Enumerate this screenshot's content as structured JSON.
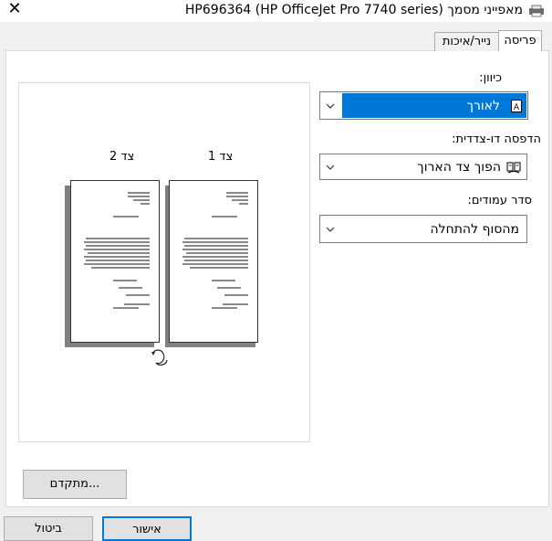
{
  "window": {
    "title": "מאפייני מסמך (HP696364 (HP OfficeJet Pro 7740 series",
    "close_glyph": "✕"
  },
  "tabs": [
    {
      "label": "פריסה",
      "selected": true
    },
    {
      "label": "נייר/איכות",
      "selected": false
    }
  ],
  "preview": {
    "side1_label": "צד 1",
    "side2_label": "צד 2"
  },
  "orientation": {
    "label": "כיוון:",
    "value": "לאורך",
    "icon": "portrait-page-icon"
  },
  "duplex": {
    "label": "הדפסה דו-צדדית:",
    "value": "הפוך צד הארוך",
    "icon": "duplex-book-icon"
  },
  "page_order": {
    "label": "סדר עמודים:",
    "value": "מהסוף להתחלה"
  },
  "buttons": {
    "advanced": "מתקדם...",
    "ok": "אישור",
    "cancel": "ביטול"
  },
  "colors": {
    "accent": "#0078d7"
  }
}
